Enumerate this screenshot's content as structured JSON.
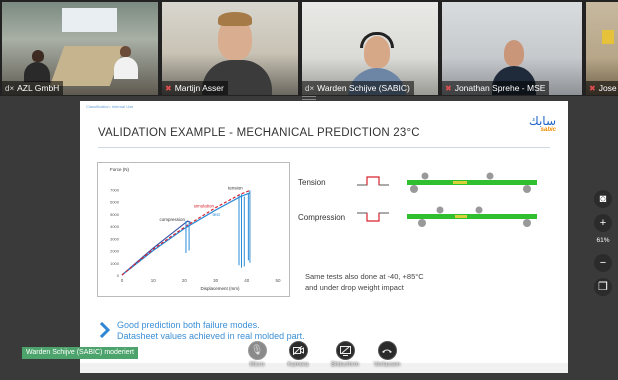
{
  "participants": [
    {
      "name": "AZL GmbH",
      "mic": "on"
    },
    {
      "name": "Martijn Asser",
      "mic": "muted"
    },
    {
      "name": "Warden Schijve (SABIC)",
      "mic": "on"
    },
    {
      "name": "Jonathan Sprehe - MSE",
      "mic": "muted"
    },
    {
      "name": "Jose",
      "mic": "muted"
    }
  ],
  "slide": {
    "confidential": "Classification: Internal Use",
    "title": "VALIDATION EXAMPLE - MECHANICAL PREDICTION  23°C",
    "logo_arabic": "سابك",
    "logo_latin": "sabic",
    "tension_label": "Tension",
    "compression_label": "Compression",
    "note_line1": "Same tests also done at -40, +85°C",
    "note_line2": "and under drop weight impact",
    "bottom_line1": "Good prediction both failure modes.",
    "bottom_line2": "Datasheet values achieved in real molded part."
  },
  "chart_data": {
    "type": "line",
    "title": "",
    "ylabel": "Force (N)",
    "xlabel": "Displacement (mm)",
    "xlim": [
      0,
      50
    ],
    "ylim": [
      0,
      8000
    ],
    "xticks": [
      "0",
      "10",
      "20",
      "30",
      "40",
      "50"
    ],
    "yticks": [
      "0",
      "1000",
      "2000",
      "3000",
      "4000",
      "5000",
      "6000",
      "7000"
    ],
    "annotations": [
      "tension",
      "simulation",
      "test",
      "compression"
    ],
    "series": [
      {
        "name": "simulation",
        "x": [
          0,
          10,
          20,
          30,
          38,
          41
        ],
        "y": [
          0,
          2100,
          3900,
          5500,
          6600,
          6900
        ]
      },
      {
        "name": "test",
        "x": [
          0,
          10,
          20,
          30,
          38,
          41
        ],
        "y": [
          0,
          2000,
          3800,
          5300,
          6400,
          6700
        ]
      },
      {
        "name": "compression",
        "x": [
          0,
          10,
          20,
          21,
          22
        ],
        "y": [
          0,
          2200,
          4200,
          4400,
          4300
        ]
      }
    ],
    "colors": {
      "simulation": "#d9232e",
      "test": "#2a8bd6",
      "compression": "#3a57a8"
    }
  },
  "badge": "Warden Schijve (SABIC) moderiert",
  "toolbar": {
    "micro": "Micro",
    "kamera": "Kamera",
    "bildschirm": "Bildschirm",
    "verlassen": "Verlassen"
  },
  "zoom": "61%"
}
